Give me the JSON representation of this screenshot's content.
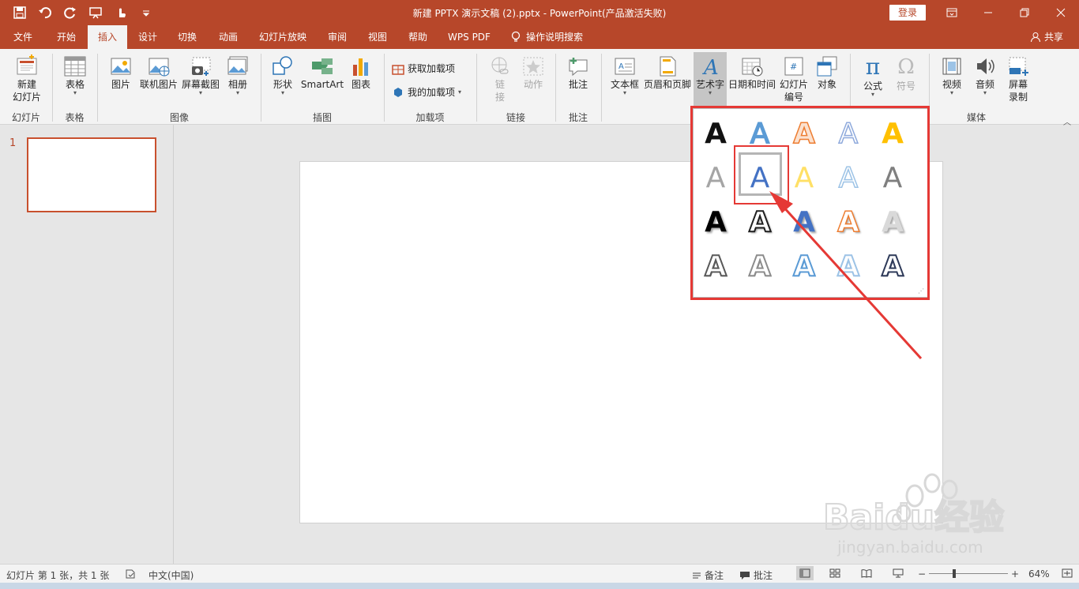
{
  "titlebar": {
    "title": "新建 PPTX 演示文稿 (2).pptx  -  PowerPoint(产品激活失败)",
    "login": "登录"
  },
  "tabs": [
    "文件",
    "开始",
    "插入",
    "设计",
    "切换",
    "动画",
    "幻灯片放映",
    "审阅",
    "视图",
    "帮助",
    "WPS PDF",
    "操作说明搜索"
  ],
  "share": "共享",
  "ribbon": {
    "buttons": {
      "new_slide": "新建\n幻灯片",
      "new_slide_l1": "新建",
      "new_slide_l2": "幻灯片",
      "table": "表格",
      "picture": "图片",
      "online_picture": "联机图片",
      "screenshot": "屏幕截图",
      "album": "相册",
      "shapes": "形状",
      "smartart": "SmartArt",
      "chart": "图表",
      "get_addins": "获取加载项",
      "my_addins": "我的加载项",
      "link_l1": "链",
      "link_l2": "接",
      "action": "动作",
      "comment": "批注",
      "textbox": "文本框",
      "header_footer": "页眉和页脚",
      "wordart": "艺术字",
      "datetime": "日期和时间",
      "slide_number_l1": "幻灯片",
      "slide_number_l2": "编号",
      "object": "对象",
      "equation": "公式",
      "symbol": "符号",
      "video": "视频",
      "audio": "音频",
      "screen_record_l1": "屏幕",
      "screen_record_l2": "录制"
    },
    "groups": {
      "slides": "幻灯片",
      "tables": "表格",
      "images": "图像",
      "illustrations": "插图",
      "addins": "加载项",
      "links": "链接",
      "comments": "批注",
      "media": "媒体"
    }
  },
  "thumbnail": {
    "number": "1"
  },
  "wordart": {
    "glyph": "A",
    "styles": [
      "#111111",
      "#5b9bd5",
      "#ed7d31",
      "#8faadc",
      "#ffc000",
      "#a5a5a5",
      "#4472c4",
      "#ffe066",
      "#9dc3e6",
      "#7f7f7f",
      "#000000",
      "#1f1f1f",
      "#4472c4",
      "#ed7d31",
      "#d9d9d9",
      "#595959",
      "#8c8c8c",
      "#5b9bd5",
      "#9dc3e6",
      "#2e3a59"
    ]
  },
  "watermark": {
    "brand": "Baidu经验",
    "url": "jingyan.baidu.com"
  },
  "statusbar": {
    "slide_info": "幻灯片 第 1 张，共 1 张",
    "language": "中文(中国)",
    "notes": "备注",
    "comments": "批注",
    "zoom": "64%"
  },
  "colors": {
    "brand": "#b7472a",
    "highlight": "#e53935"
  }
}
